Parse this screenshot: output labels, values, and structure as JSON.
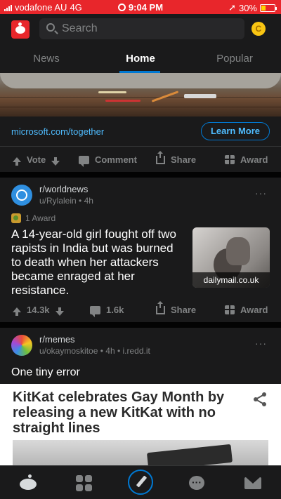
{
  "status_bar": {
    "carrier": "vodafone AU",
    "network": "4G",
    "time": "9:04 PM",
    "battery": "30%",
    "battery_level": 0.3
  },
  "header": {
    "search_placeholder": "Search",
    "coin_label": "C"
  },
  "tabs": [
    {
      "label": "News",
      "active": false
    },
    {
      "label": "Home",
      "active": true
    },
    {
      "label": "Popular",
      "active": false
    }
  ],
  "promoted": {
    "link_text": "microsoft.com/together",
    "cta_label": "Learn More",
    "actions": {
      "vote": "Vote",
      "comment": "Comment",
      "share": "Share",
      "award": "Award"
    }
  },
  "posts": [
    {
      "subreddit": "r/worldnews",
      "author": "u/Rylalein",
      "age": "4h",
      "award_text": "1 Award",
      "title": "A 14-year-old girl fought off two rapists in India but was burned to death when her attackers became enraged at her resistance.",
      "thumbnail_caption": "dailymail.co.uk",
      "votes": "14.3k",
      "comments": "1.6k",
      "share": "Share",
      "award": "Award"
    },
    {
      "subreddit": "r/memes",
      "author": "u/okaymoskitoe",
      "age": "4h",
      "domain": "i.redd.it",
      "title": "One tiny error",
      "image_headline": "KitKat celebrates Gay Month by releasing a new KitKat with no straight lines"
    }
  ],
  "colors": {
    "accent": "#0079d3",
    "brand": "#e8262b",
    "link": "#4fbcff",
    "background": "#1a1a1b"
  }
}
